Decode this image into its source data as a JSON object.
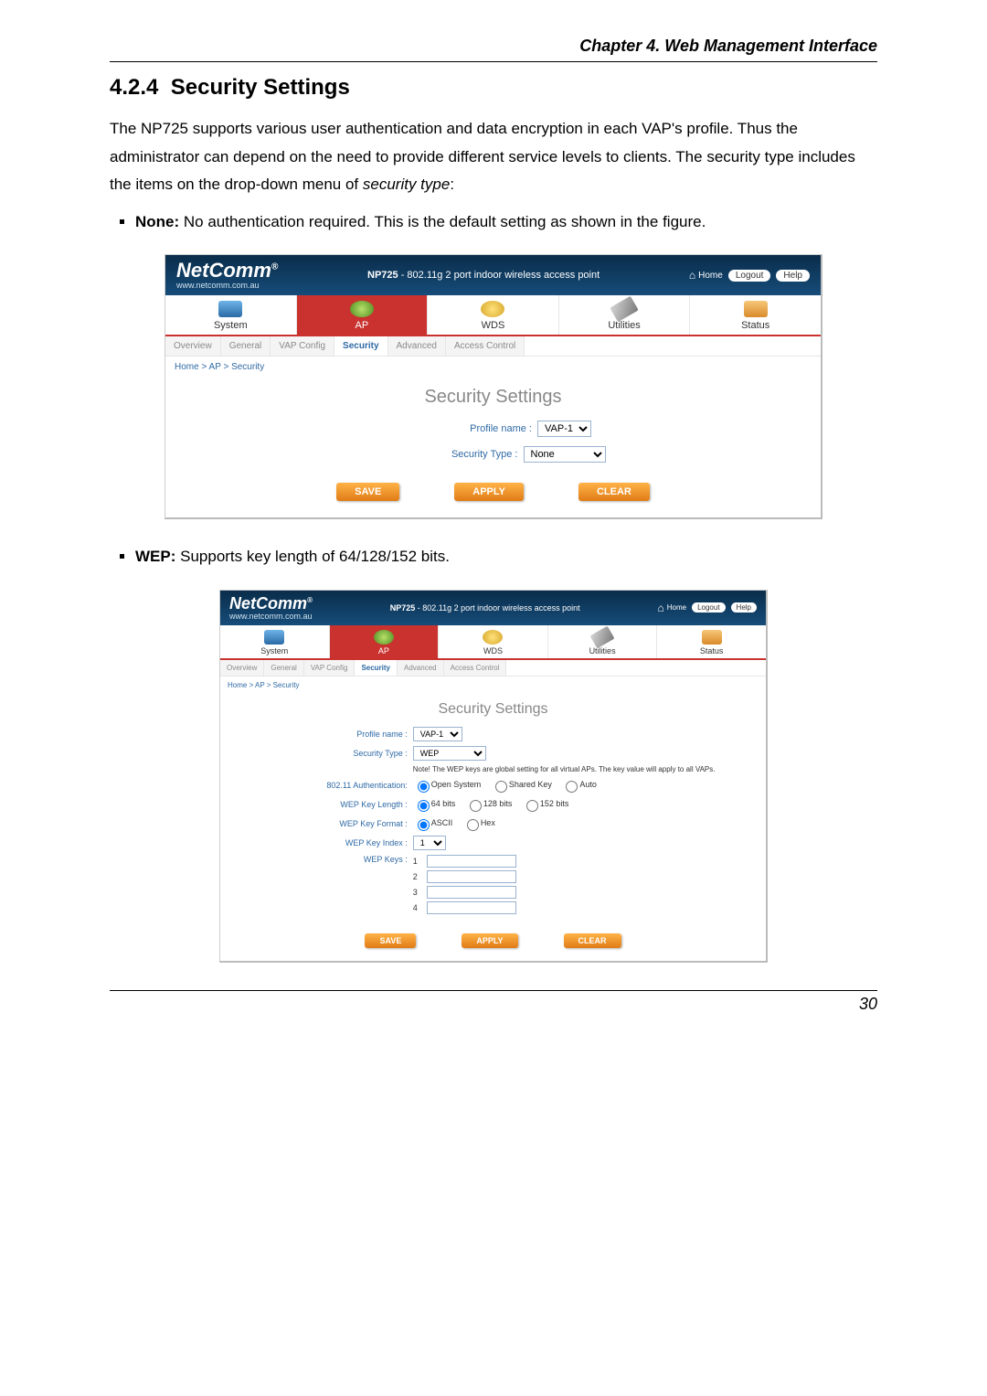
{
  "doc": {
    "chapter": "Chapter 4. Web Management Interface",
    "section_no": "4.2.4",
    "section_title": "Security Settings",
    "para1": "The NP725 supports various user authentication and data encryption in each VAP's profile. Thus the administrator can depend on the need to provide different service levels to clients. The security type includes the items on the drop-down menu of ",
    "para1_em": "security type",
    "para1_tail": ":",
    "bullet_none_b": "None:",
    "bullet_none": " No authentication required. This is the default setting as shown in the figure.",
    "bullet_wep_b": "WEP:",
    "bullet_wep": " Supports key length of 64/128/152 bits.",
    "page_number": "30"
  },
  "ui": {
    "brand": "NetComm",
    "brand_sub": "www.netcomm.com.au",
    "product_line_pre": "NP725",
    "product_line": " - 802.11g 2 port indoor wireless access point",
    "home": "Home",
    "logout": "Logout",
    "help": "Help",
    "nav": {
      "system": "System",
      "ap": "AP",
      "wds": "WDS",
      "utilities": "Utilities",
      "status": "Status"
    },
    "subnav": {
      "overview": "Overview",
      "general": "General",
      "vap": "VAP Config",
      "security": "Security",
      "advanced": "Advanced",
      "access": "Access Control"
    },
    "breadcrumb": "Home > AP > Security",
    "panel_title": "Security Settings",
    "profile_label": "Profile name :",
    "profile_value": "VAP-1",
    "security_label": "Security Type :",
    "security_none": "None",
    "security_wep": "WEP",
    "wep_note": "Note! The WEP keys are global setting for all virtual APs. The key value will apply to all VAPs.",
    "auth_label": "802.11 Authentication:",
    "auth_open": "Open System",
    "auth_shared": "Shared Key",
    "auth_auto": "Auto",
    "keylen_label": "WEP Key Length :",
    "keylen_64": "64 bits",
    "keylen_128": "128 bits",
    "keylen_152": "152 bits",
    "keyfmt_label": "WEP Key Format :",
    "keyfmt_ascii": "ASCII",
    "keyfmt_hex": "Hex",
    "keyidx_label": "WEP Key Index :",
    "keyidx_value": "1",
    "keys_label": "WEP Keys :",
    "keys": [
      "1",
      "2",
      "3",
      "4"
    ],
    "btn_save": "SAVE",
    "btn_apply": "APPLY",
    "btn_clear": "CLEAR"
  }
}
